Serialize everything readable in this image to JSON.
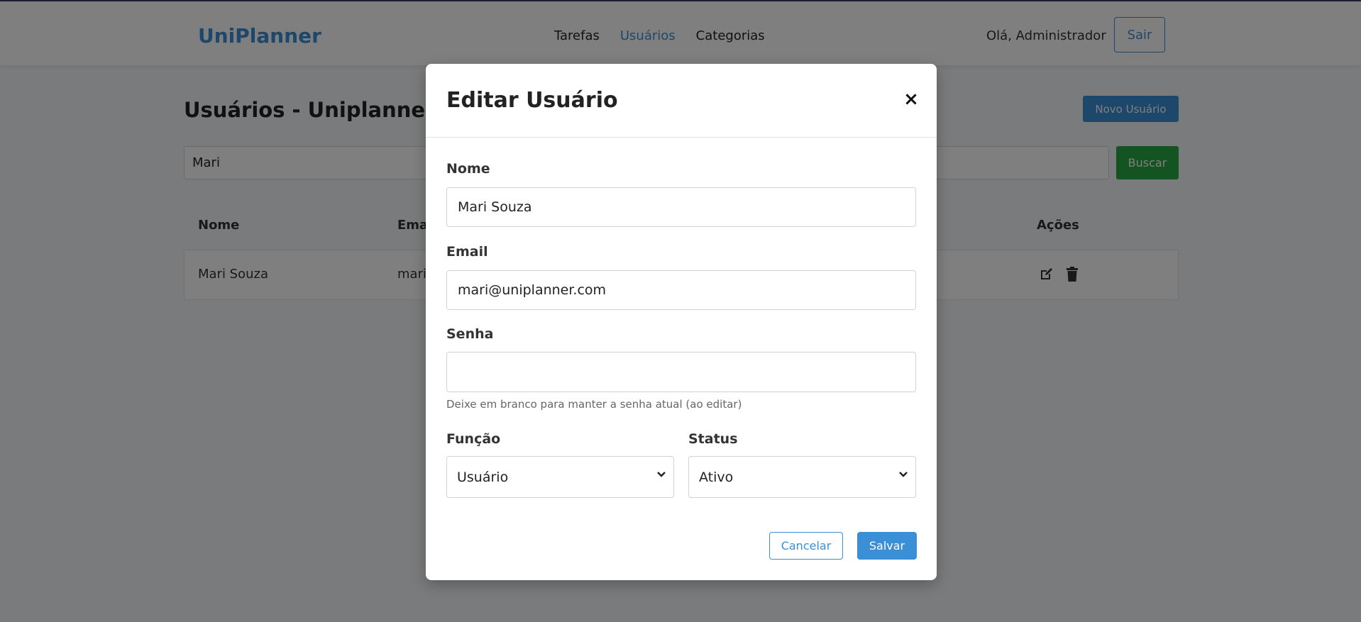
{
  "header": {
    "brand": "UniPlanner",
    "nav": [
      "Tarefas",
      "Usuários",
      "Categorias"
    ],
    "active_nav": "Usuários",
    "greeting": "Olá, Administrador",
    "logout_label": "Sair"
  },
  "page": {
    "title": "Usuários - Uniplanner",
    "new_user_label": "Novo Usuário",
    "search_value": "Mari",
    "search_button": "Buscar"
  },
  "table": {
    "columns": [
      "Nome",
      "Emai",
      "Ações"
    ],
    "rows": [
      {
        "nome": "Mari Souza",
        "email": "mari"
      }
    ]
  },
  "modal": {
    "title": "Editar Usuário",
    "close_symbol": "×",
    "name_label": "Nome",
    "name_value": "Mari Souza",
    "email_label": "Email",
    "email_value": "mari@uniplanner.com",
    "password_label": "Senha",
    "password_value": "",
    "password_help": "Deixe em branco para manter a senha atual (ao editar)",
    "role_label": "Função",
    "role_value": "Usuário",
    "status_label": "Status",
    "status_value": "Ativo",
    "cancel_label": "Cancelar",
    "save_label": "Salvar"
  },
  "colors": {
    "accent": "#3a8fd6",
    "success": "#28a745",
    "overlay": "rgba(0,0,0,0.5)"
  }
}
